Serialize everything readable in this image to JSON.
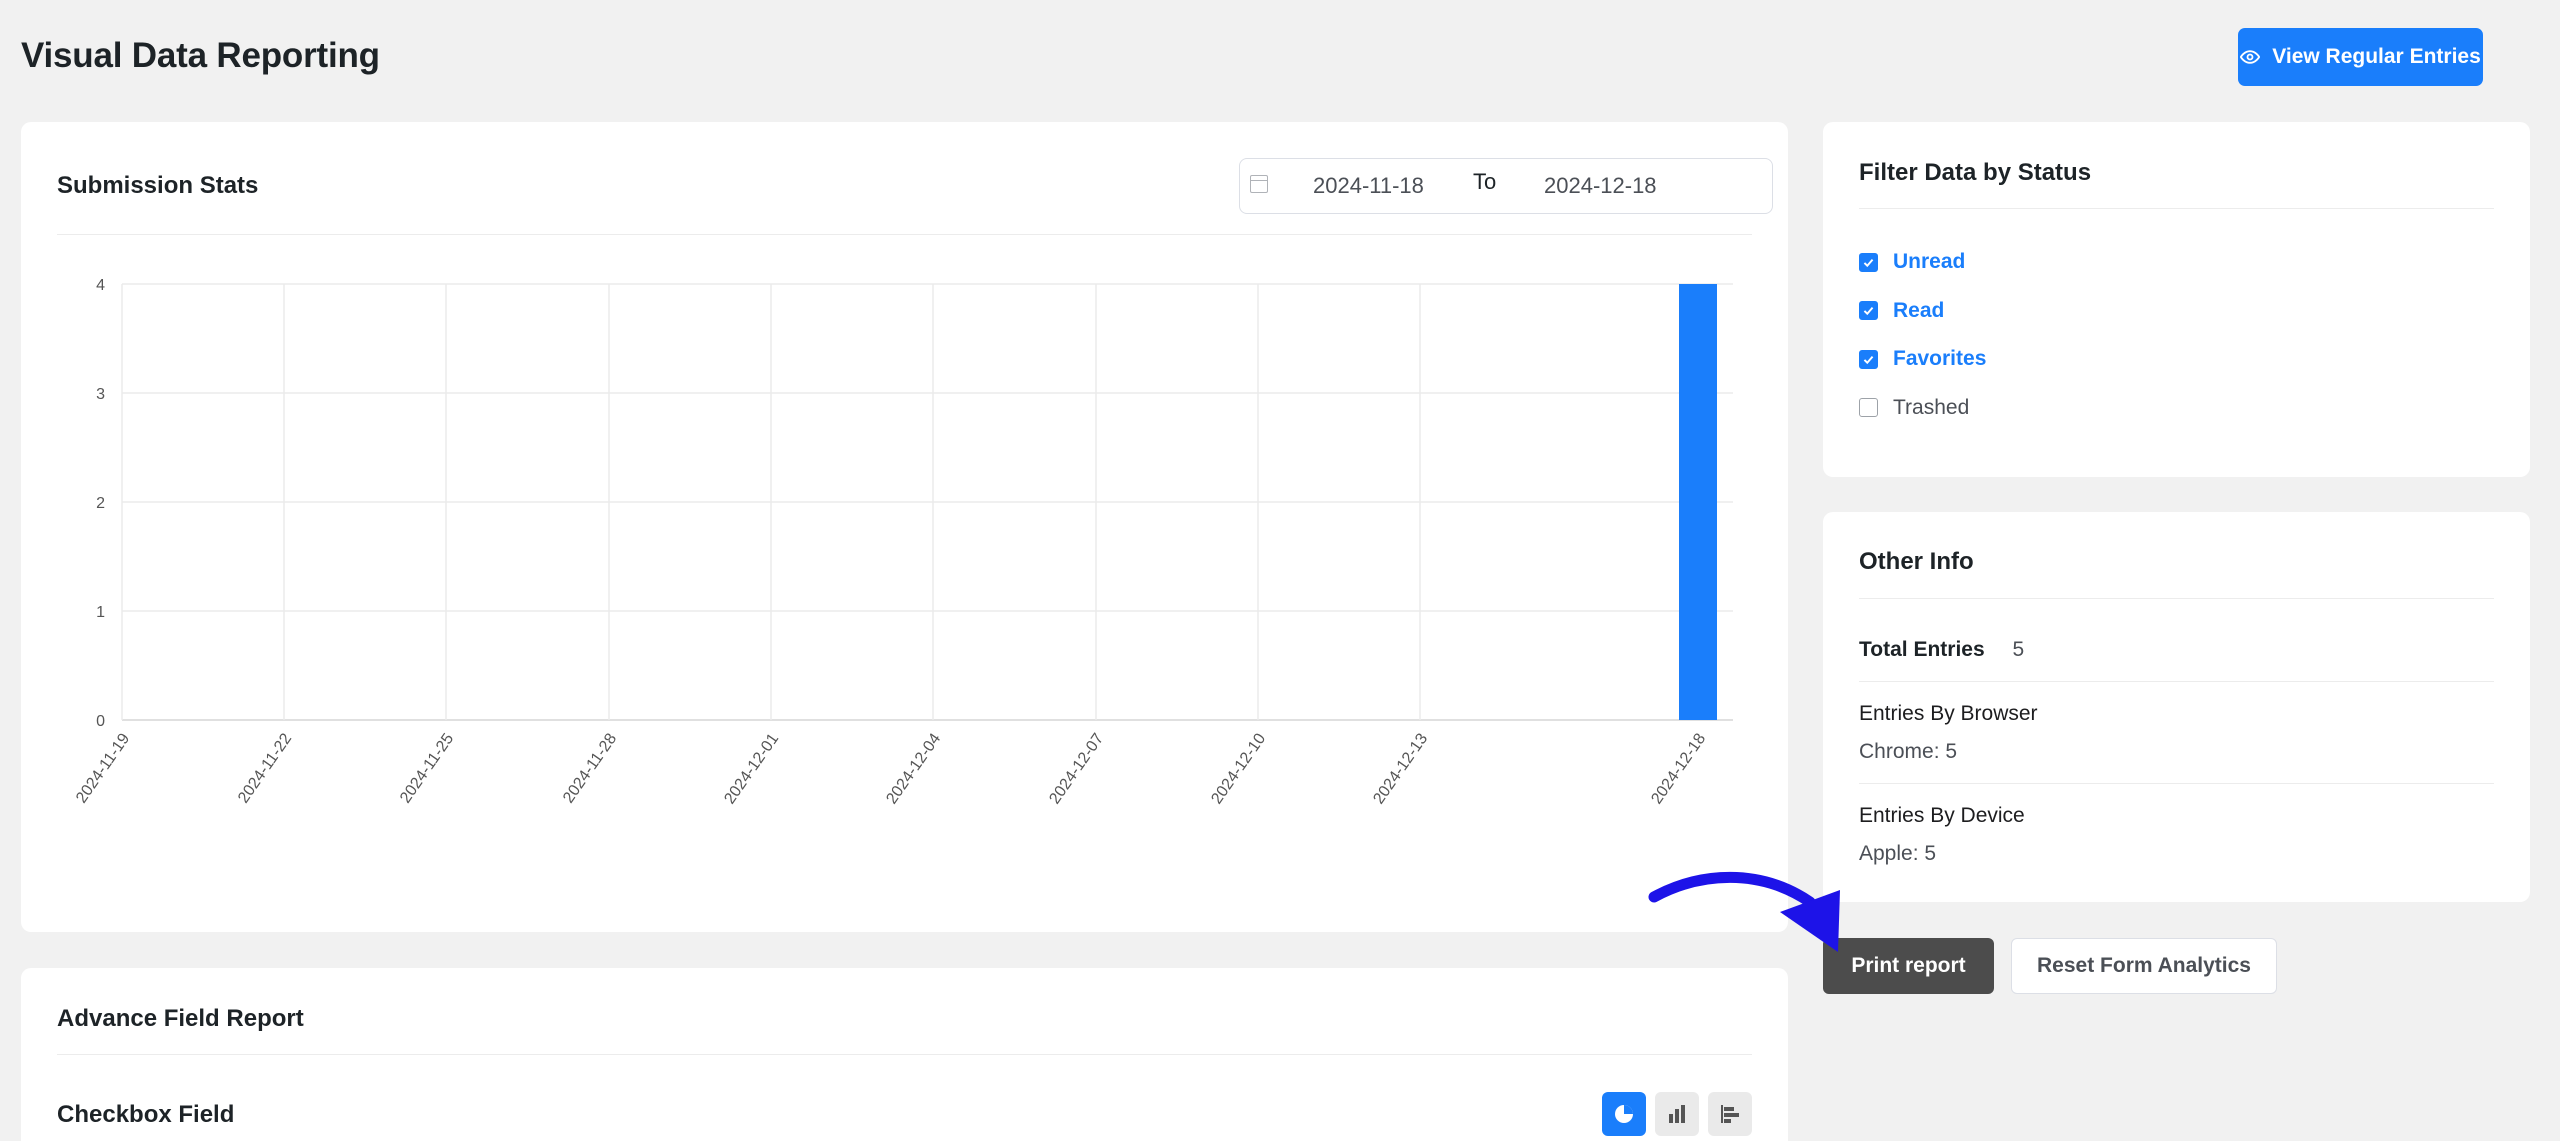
{
  "header": {
    "title": "Visual Data Reporting",
    "view_button_label": "View Regular Entries"
  },
  "submission_stats": {
    "title": "Submission Stats",
    "date_from": "2024-11-18",
    "date_to_label": "To",
    "date_to": "2024-12-18"
  },
  "chart_data": {
    "type": "bar",
    "title": "",
    "xlabel": "",
    "ylabel": "",
    "x_tick_labels": [
      "2024-11-19",
      "2024-11-22",
      "2024-11-25",
      "2024-11-28",
      "2024-12-01",
      "2024-12-04",
      "2024-12-07",
      "2024-12-10",
      "2024-12-13",
      "2024-12-18"
    ],
    "categories": [
      "2024-12-18"
    ],
    "values": [
      4
    ],
    "ylim": [
      0,
      4
    ],
    "y_ticks": [
      0,
      1,
      2,
      3,
      4
    ],
    "grid": true,
    "color": "#1a7efb"
  },
  "filter": {
    "title": "Filter Data by Status",
    "statuses": [
      {
        "label": "Unread",
        "checked": true
      },
      {
        "label": "Read",
        "checked": true
      },
      {
        "label": "Favorites",
        "checked": true
      },
      {
        "label": "Trashed",
        "checked": false
      }
    ]
  },
  "other_info": {
    "title": "Other Info",
    "total_entries_label": "Total Entries",
    "total_entries_value": "5",
    "browser_label": "Entries By Browser",
    "browser_value": "Chrome: 5",
    "device_label": "Entries By Device",
    "device_value": "Apple: 5"
  },
  "actions": {
    "print_label": "Print report",
    "reset_label": "Reset Form Analytics"
  },
  "advance_report": {
    "title": "Advance Field Report",
    "field_title": "Checkbox Field",
    "chart_types": [
      "pie-chart-icon",
      "bar-chart-icon",
      "horizontal-bar-chart-icon"
    ]
  },
  "colors": {
    "accent": "#1a7efb",
    "dark_button": "#4c4c4c",
    "annotation_arrow": "#1d13e8"
  }
}
